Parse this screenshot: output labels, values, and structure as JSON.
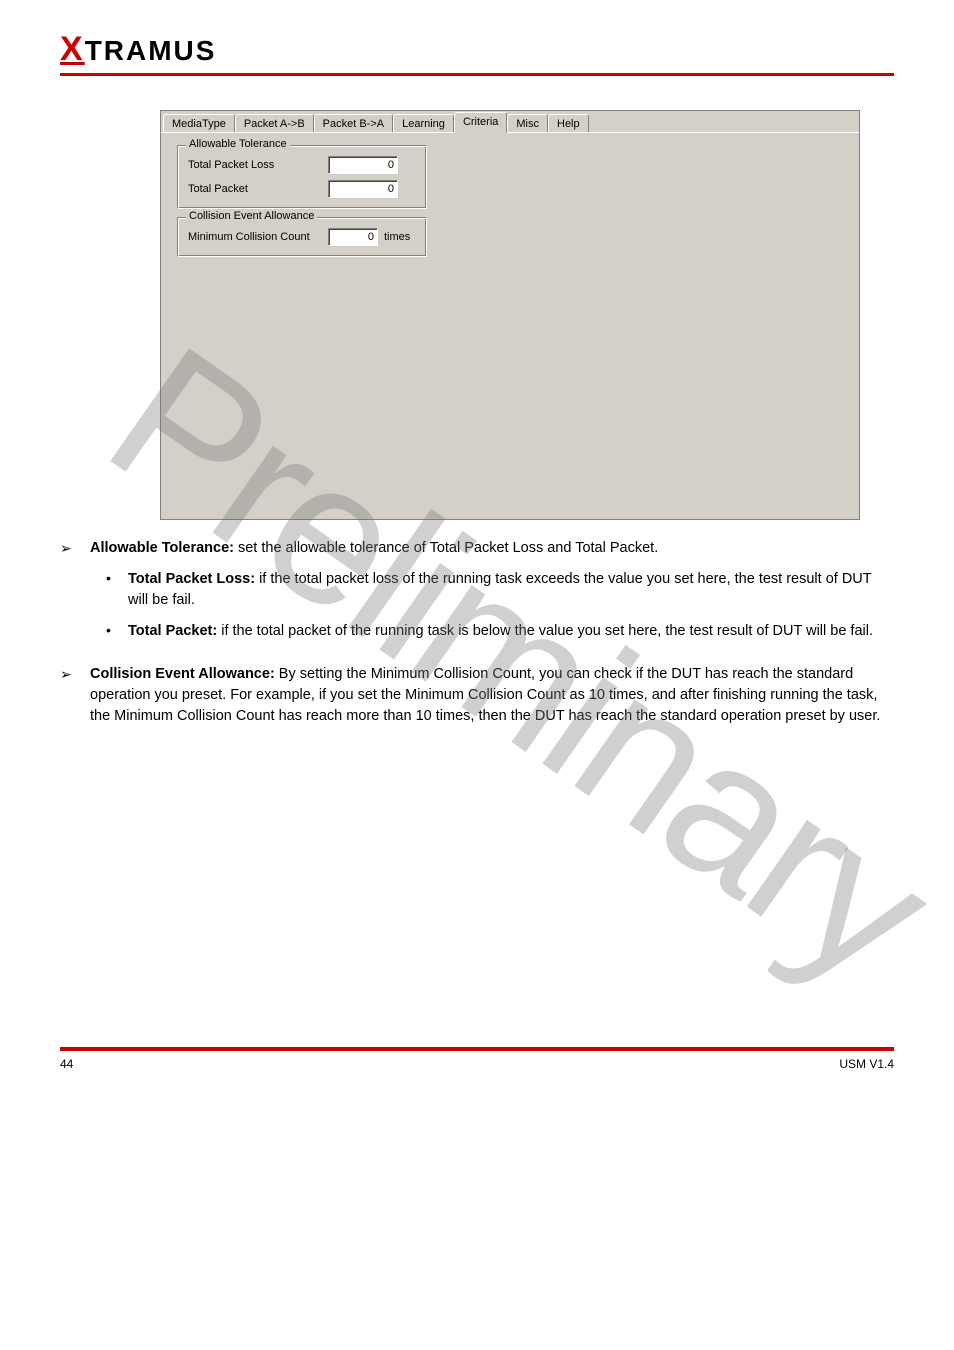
{
  "logo": {
    "x": "X",
    "rest": "TRAMUS"
  },
  "watermark": "Preliminary",
  "dialog": {
    "tabs": [
      "MediaType",
      "Packet A->B",
      "Packet B->A",
      "Learning",
      "Criteria",
      "Misc",
      "Help"
    ],
    "active_tab_index": 4,
    "group_allowable": {
      "legend": "Allowable Tolerance",
      "total_packet_loss_label": "Total Packet Loss",
      "total_packet_loss_value": "0",
      "total_packet_label": "Total Packet",
      "total_packet_value": "0"
    },
    "group_collision": {
      "legend": "Collision Event Allowance",
      "min_collision_label": "Minimum Collision Count",
      "min_collision_value": "0",
      "min_collision_unit": "times"
    }
  },
  "doc": {
    "sec1_title": "Allowable Tolerance:",
    "sec1_intro": " set the allowable tolerance of Total Packet Loss and Total Packet.",
    "b1_label": "Total Packet Loss:",
    "b1_text": " if the total packet loss of the running task exceeds the value you set here, the test result of DUT will be fail.",
    "b2_label": "Total Packet:",
    "b2_text": " if the total packet of the running task is below the value you set here, the test result of DUT will be fail.",
    "sec2_title": "Collision Event Allowance:",
    "sec2_intro": " By setting the Minimum Collision Count, you can check if the DUT has reach the standard operation you preset. For example, if you set the Minimum Collision Count as 10 times, and after finishing running the task, the Minimum Collision Count has reach more than 10 times, then the DUT has reach the standard operation preset by user."
  },
  "footer": {
    "left": "44",
    "right": "USM V1.4"
  }
}
